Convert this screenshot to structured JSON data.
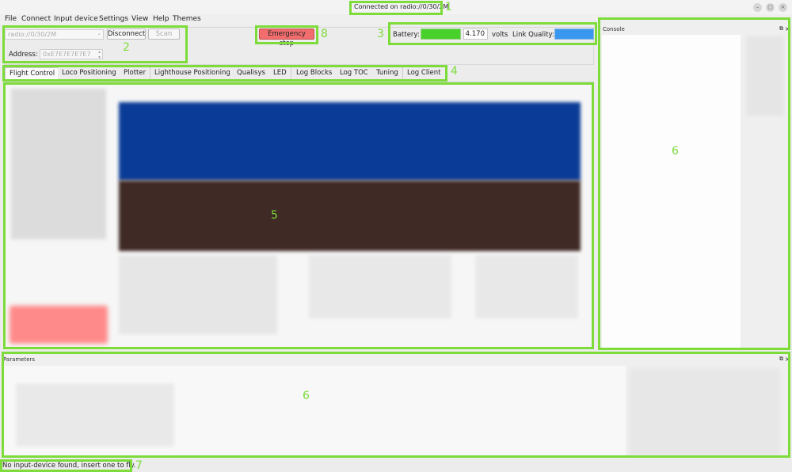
{
  "window": {
    "title": "Connected on radio://0/30/2M",
    "controls": [
      "–",
      "□",
      "×"
    ]
  },
  "menu": [
    "File",
    "Connect",
    "Input device",
    "Settings",
    "View",
    "Help",
    "Themes"
  ],
  "connection": {
    "uri": "radio://0/30/2M",
    "disconnect_label": "Disconnect",
    "scan_label": "Scan",
    "address_label": "Address:",
    "address_value": "0xE7E7E7E7E7"
  },
  "emergency_label": "Emergency stop",
  "battery": {
    "label": "Battery:",
    "voltage": "4.170",
    "unit": "volts",
    "link_label": "Link Quality:",
    "battery_color": "#47d12a",
    "link_color": "#3a97f0"
  },
  "tabs": [
    "Flight Control",
    "Loco Positioning",
    "Plotter",
    "Lighthouse Positioning",
    "Qualisys",
    "LED",
    "Log Blocks",
    "Log TOC",
    "Tuning",
    "Log Client"
  ],
  "console": {
    "title": "Console"
  },
  "parameters": {
    "title": "Parameters"
  },
  "status": "No input-device found, insert one to fly.",
  "annotations": {
    "a1": "1",
    "a2": "2",
    "a3": "3",
    "a4": "4",
    "a5": "5",
    "a6a": "6",
    "a6b": "6",
    "a7": "7",
    "a8": "8"
  }
}
